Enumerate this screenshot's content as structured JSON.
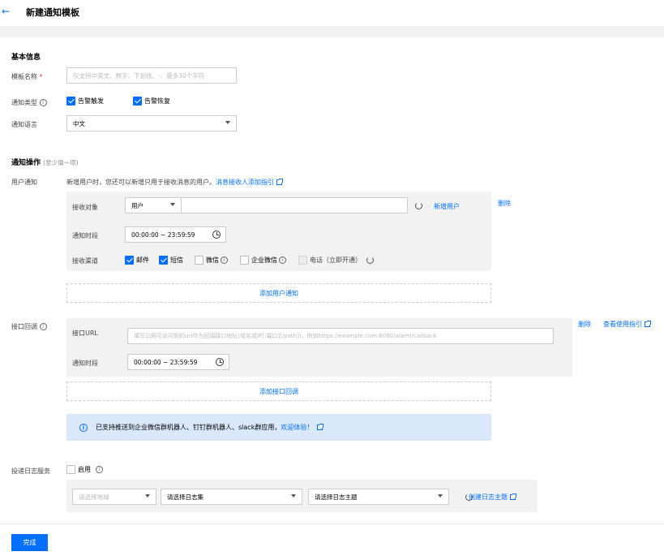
{
  "header": {
    "title": "新建通知模板"
  },
  "basic": {
    "section_title": "基本信息",
    "name_label": "模板名称",
    "required_mark": "*",
    "name_placeholder": "仅支持中英文、数字、下划线、-、最多30个字符",
    "type_label": "通知类型",
    "type_options": [
      {
        "label": "告警触发",
        "checked": true
      },
      {
        "label": "告警恢复",
        "checked": true
      }
    ],
    "lang_label": "通知语言",
    "lang_value": "中文"
  },
  "ops": {
    "section_title": "通知操作",
    "section_hint": "(至少填一项)",
    "user_label": "用户通知",
    "user_desc": "新增用户时，您还可以新增只用于接收消息的用户。",
    "user_guide_link": "消息接收人添加指引",
    "recipient_label": "接收对象",
    "recipient_type": "用户",
    "add_user_link": "新增用户",
    "delete_link": "删除",
    "period_label": "通知时段",
    "period_value": "00:00:00 ~ 23:59:59",
    "channel_label": "接收渠道",
    "channels": [
      {
        "label": "邮件",
        "checked": true
      },
      {
        "label": "短信",
        "checked": true
      },
      {
        "label": "微信",
        "checked": false
      },
      {
        "label": "企业微信",
        "checked": false
      },
      {
        "label": "电话（立即开通）",
        "checked": false,
        "disabled": true
      }
    ],
    "add_user_notice": "添加用户通知",
    "callback_label": "接口回调",
    "callback_url_label": "接口URL",
    "callback_url_placeholder": "填写公网可访问到的url作为回调接口地址(域名或IP[:端口][/path])，例如https://example.com:8080/alarm/callback",
    "callback_period_label": "通知时段",
    "callback_period_value": "00:00:00 ~ 23:59:59",
    "callback_delete": "删除",
    "callback_guide": "查看使用指引",
    "add_callback": "添加接口回调",
    "notice_text": "已支持推送到企业微信群机器人、钉钉群机器人、slack群应用，",
    "notice_link": "欢迎体验！"
  },
  "log": {
    "label": "投递日志服务",
    "enable_label": "启用",
    "region_placeholder": "请选择地域",
    "logset_placeholder": "请选择日志集",
    "topic_placeholder": "请选择日志主题",
    "create_topic_link": "创建日志主题"
  },
  "footer": {
    "submit": "完成"
  }
}
